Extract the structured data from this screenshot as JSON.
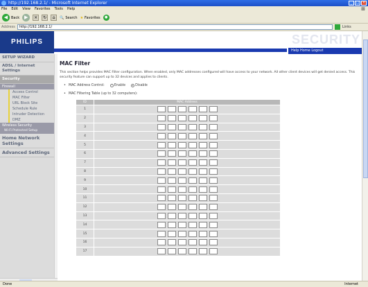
{
  "window": {
    "title": "http://192.168.2.1/ - Microsoft Internet Explorer",
    "menu": [
      "File",
      "Edit",
      "View",
      "Favorites",
      "Tools",
      "Help"
    ],
    "toolbar": {
      "back": "Back",
      "search": "Search",
      "favorites": "Favorites"
    },
    "address_label": "Address",
    "address": "http://192.168.2.1/",
    "go": "Go",
    "links": "Links",
    "status": "Done",
    "zone": "Internet"
  },
  "header": {
    "logo": "PHILIPS",
    "section": "SECURITY",
    "help_links": "Help  Home  Logout"
  },
  "sidebar": {
    "setup_wizard": "SETUP WIZARD",
    "adsl_internet": "ADSL / Internet Settings",
    "security": "Security",
    "firewall": "Firewall",
    "items": [
      "Access Control",
      "MAC Filter",
      "URL Block Site",
      "Schedule Rule",
      "Intruder Detection",
      "DMZ"
    ],
    "wireless_security": "Wireless Security",
    "wps_setup": "Wi-Fi Protected Setup",
    "home_network": "Home Network Settings",
    "advanced": "Advanced Settings"
  },
  "content": {
    "title": "MAC Filter",
    "description": "This section helps provides MAC Filter configuration. When enabled, only MAC addresses configured will have access to your network. All other client devices will get denied access. This security feature can support up to 32 devices and applies to clients.",
    "control_label": "MAC Address Control:",
    "enable": "Enable",
    "disable": "Disable",
    "control_value": "Disable",
    "table_label": "MAC Filtering Table (up to 32 computers):",
    "col_id": "ID",
    "col_addr": "MAC Address",
    "rows": [
      "1",
      "2",
      "3",
      "4",
      "5",
      "6",
      "7",
      "8",
      "9",
      "10",
      "11",
      "12",
      "13",
      "14",
      "15",
      "16",
      "17"
    ]
  }
}
